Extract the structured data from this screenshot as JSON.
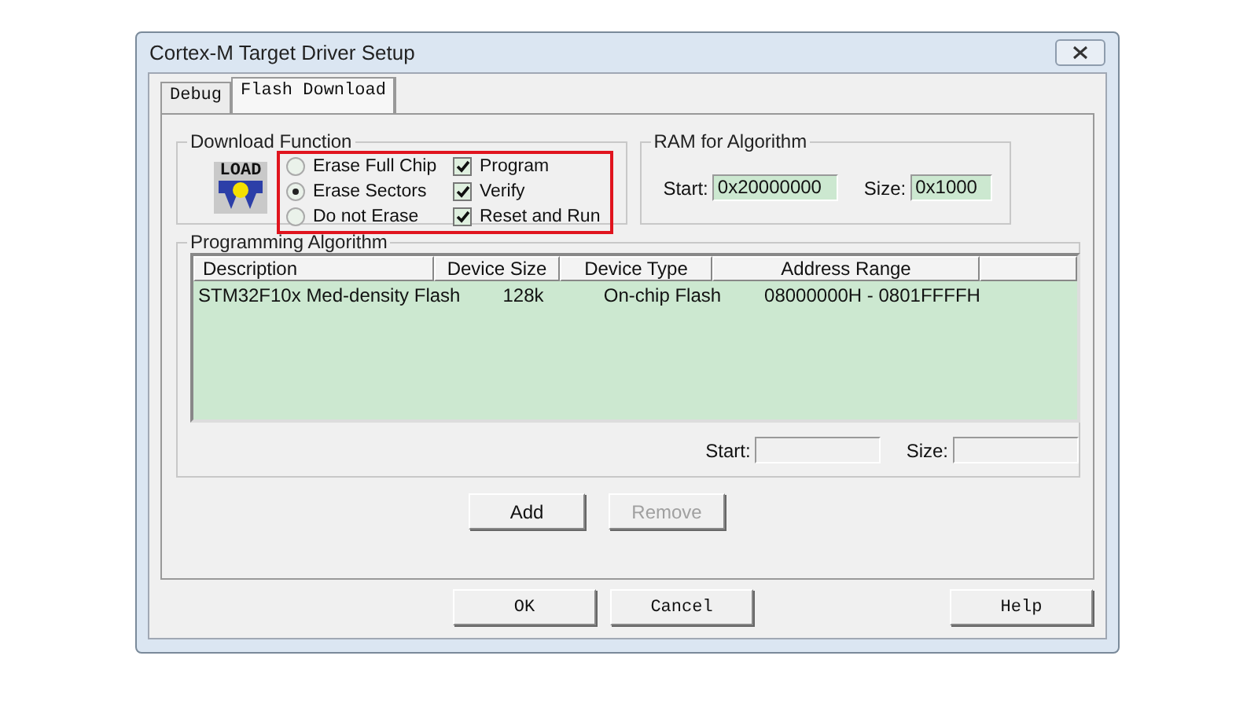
{
  "window": {
    "title": "Cortex-M Target Driver Setup"
  },
  "tabs": [
    {
      "label": "Debug",
      "selected": false
    },
    {
      "label": "Flash Download",
      "selected": true
    }
  ],
  "download_function": {
    "title": "Download Function",
    "icon_label": "LOAD",
    "highlighted": true,
    "erase_options": [
      {
        "label": "Erase Full Chip",
        "selected": false
      },
      {
        "label": "Erase Sectors",
        "selected": true
      },
      {
        "label": "Do not Erase",
        "selected": false
      }
    ],
    "actions": [
      {
        "label": "Program",
        "checked": true
      },
      {
        "label": "Verify",
        "checked": true
      },
      {
        "label": "Reset and Run",
        "checked": true
      }
    ]
  },
  "ram": {
    "title": "RAM for Algorithm",
    "start_label": "Start:",
    "start": "0x20000000",
    "size_label": "Size:",
    "size": "0x1000"
  },
  "algorithm": {
    "title": "Programming Algorithm",
    "columns": [
      "Description",
      "Device Size",
      "Device Type",
      "Address Range"
    ],
    "rows": [
      {
        "cells": [
          "STM32F10x Med-density Flash",
          "128k",
          "On-chip Flash",
          "08000000H - 0801FFFFH"
        ]
      }
    ],
    "start_label": "Start:",
    "size_label": "Size:",
    "buttons": [
      {
        "label": "Add",
        "disabled": false
      },
      {
        "label": "Remove",
        "disabled": true
      }
    ]
  },
  "buttons": [
    {
      "label": "OK",
      "kind": "left"
    },
    {
      "label": "Cancel",
      "kind": "left"
    },
    {
      "label": "Help",
      "kind": "right"
    }
  ]
}
